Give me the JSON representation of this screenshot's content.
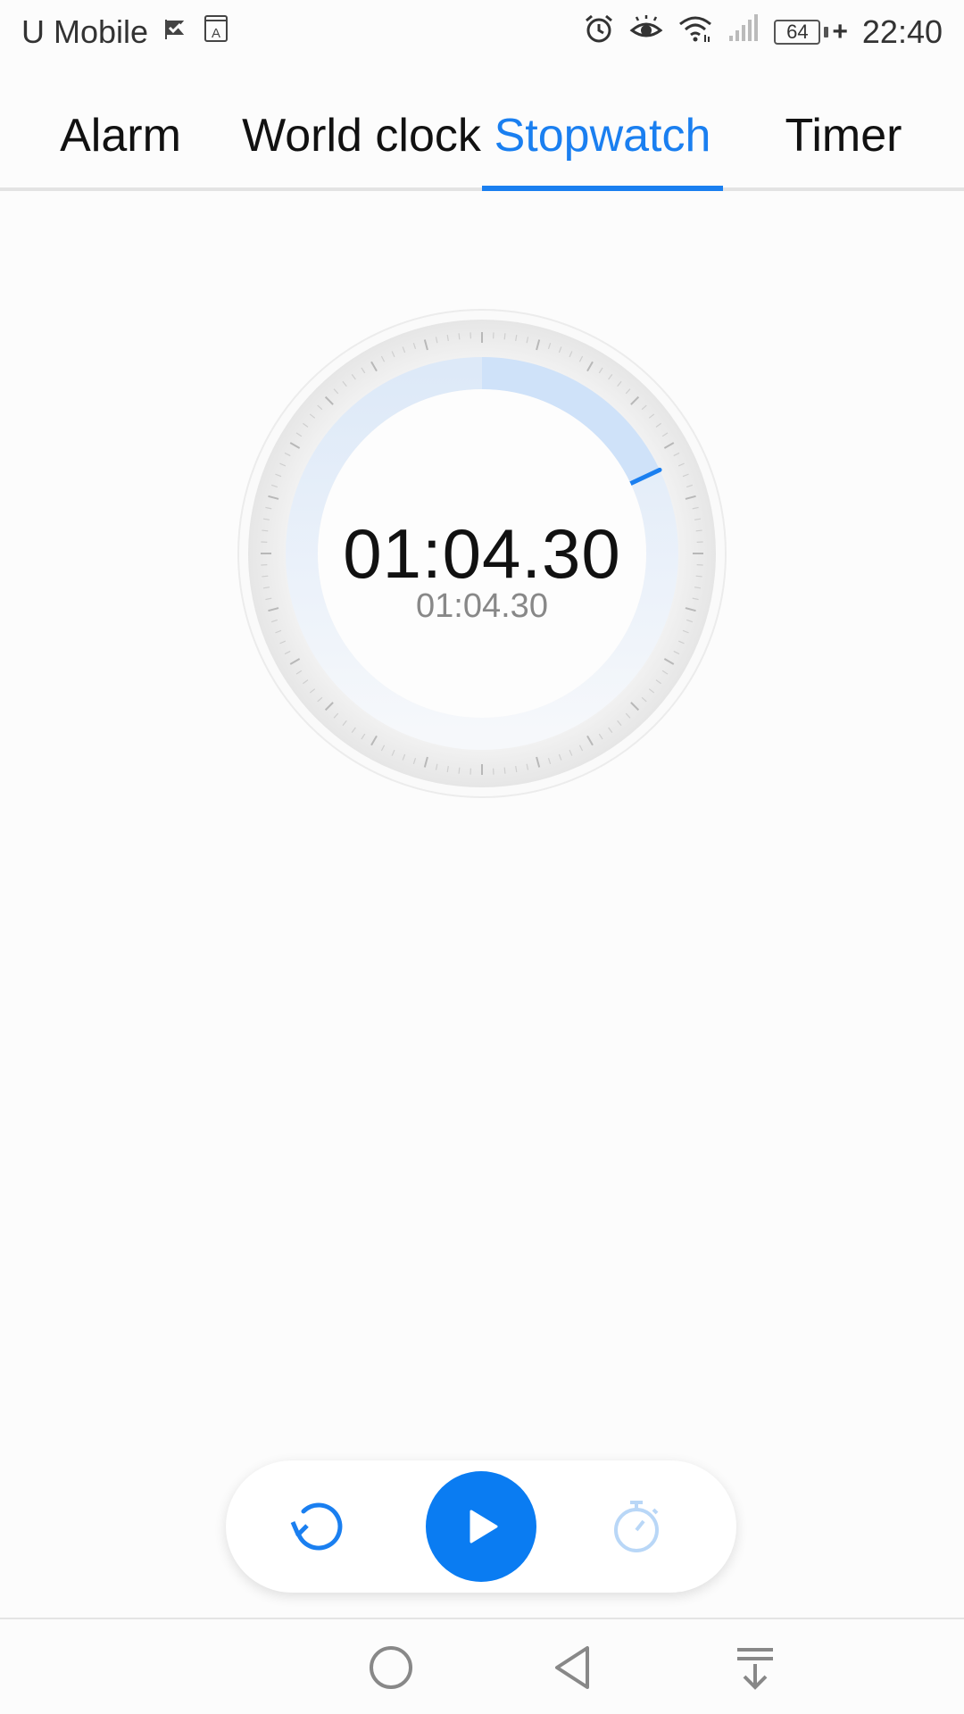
{
  "status_bar": {
    "carrier": "U Mobile",
    "battery_level": "64",
    "time": "22:40",
    "icons": [
      "check-flag-icon",
      "translate-icon",
      "alarm-icon",
      "eye-icon",
      "wifi-icon",
      "signal-icon",
      "battery-icon",
      "charging-icon"
    ]
  },
  "tabs": [
    {
      "label": "Alarm"
    },
    {
      "label": "World clock"
    },
    {
      "label": "Stopwatch",
      "active": true
    },
    {
      "label": "Timer"
    }
  ],
  "stopwatch": {
    "elapsed": "01:04.30",
    "lap_time": "01:04.30",
    "progress_fraction": 0.18
  },
  "controls": {
    "reset_icon": "reset-icon",
    "play_icon": "play-icon",
    "lap_icon": "lap-stopwatch-icon"
  },
  "nav_bar": {
    "icons": [
      "home-icon",
      "back-icon",
      "notification-drawer-icon"
    ]
  },
  "colors": {
    "accent": "#1a7ff0",
    "background": "#fcfcfc",
    "progress_track": "#d6e6fa"
  }
}
